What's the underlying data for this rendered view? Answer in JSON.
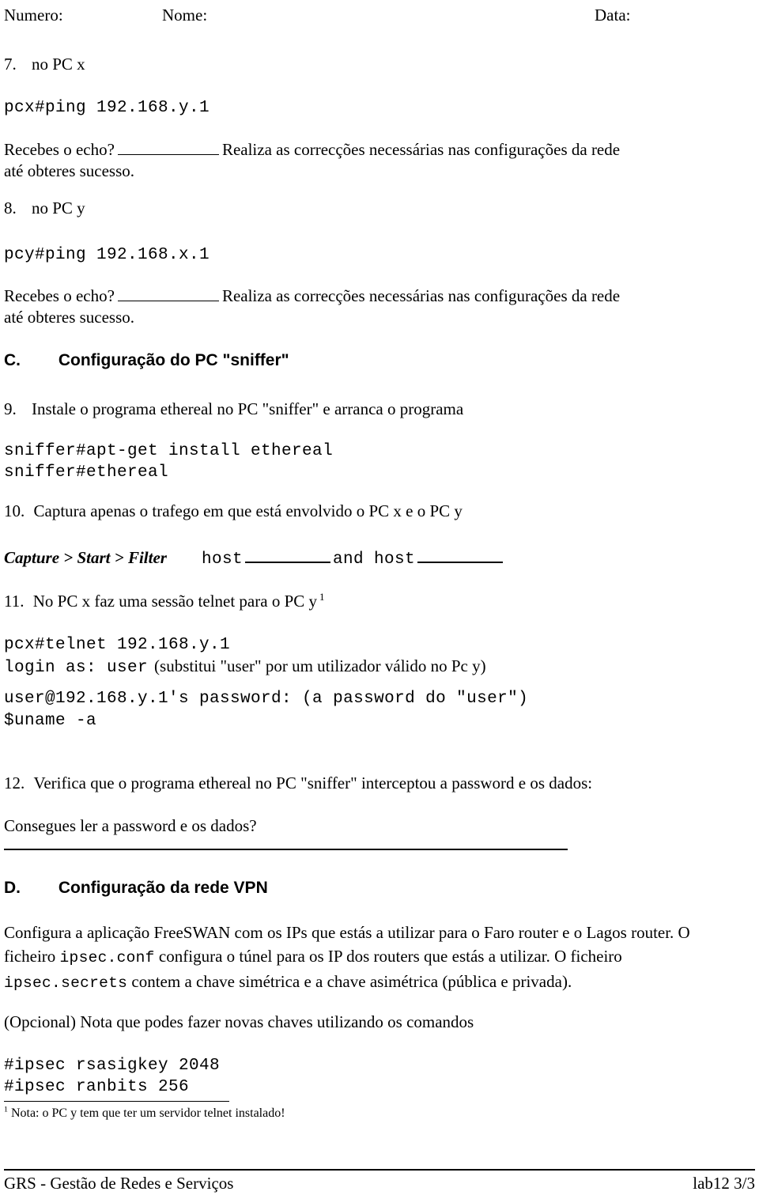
{
  "header": {
    "numero_label": "Numero:",
    "nome_label": "Nome:",
    "data_label": "Data:"
  },
  "items": {
    "item7": {
      "number": "7.",
      "text": "no PC x",
      "code": "pcx#ping 192.168.y.1",
      "question_before": "Recebes o echo?",
      "question_after": "Realiza as correcções necessárias nas configurações da rede",
      "question_line2": "até obteres sucesso."
    },
    "item8": {
      "number": "8.",
      "text": "no PC y",
      "code": "pcy#ping 192.168.x.1",
      "question_before": "Recebes o echo?",
      "question_after": "Realiza as correcções necessárias nas configurações da rede",
      "question_line2": "até obteres sucesso."
    },
    "item9": {
      "number": "9.",
      "text": "Instale o programa ethereal no PC \"sniffer\" e arranca o programa",
      "code_line1": "sniffer#apt-get install ethereal",
      "code_line2": "sniffer#ethereal"
    },
    "item10": {
      "number": "10.",
      "text": "Captura apenas o trafego em que está envolvido o PC x  e o PC y",
      "menu_path": "Capture > Start > Filter",
      "filter_host1": "host",
      "filter_and": "and host"
    },
    "item11": {
      "number": "11.",
      "text": "No PC x  faz uma sessão telnet para o PC y",
      "footnote_marker": "1",
      "code_line1": "pcx#telnet 192.168.y.1",
      "code_line2_mono": "login as: user",
      "code_line2_serif": "(substitui \"user\" por um utilizador válido no Pc y)",
      "code_line3": "user@192.168.y.1's password: (a password do \"user\")",
      "code_line4": "$uname -a"
    },
    "item12": {
      "number": "12.",
      "text": "Verifica que o programa ethereal no PC \"sniffer\" interceptou a password e os dados:",
      "question": "Consegues ler a password e os dados?"
    }
  },
  "sections": {
    "c": {
      "letter": "C.",
      "title": "Configuração do PC \"sniffer\""
    },
    "d": {
      "letter": "D.",
      "title": "Configuração  da rede VPN"
    }
  },
  "vpn": {
    "para1_a": "Configura a aplicação FreeSWAN com os IPs que estás a utilizar para o Faro router e o Lagos router. O ficheiro ",
    "para1_mono1": "ipsec.conf",
    "para1_b": " configura o túnel para os IP dos routers que estás a utilizar. O ficheiro ",
    "para1_mono2": "ipsec.secrets",
    "para1_c": " contem a chave simétrica e a chave asimétrica (pública e privada).",
    "para2": "(Opcional) Nota que podes fazer novas chaves utilizando os comandos",
    "code_line1": "#ipsec rsasigkey 2048",
    "code_line2": "#ipsec ranbits 256"
  },
  "footnote": {
    "marker": "1",
    "text": "Nota: o PC y tem que ter um servidor telnet instalado!"
  },
  "footer": {
    "left": "GRS - Gestão de Redes e Serviços",
    "right": "lab12 3/3"
  }
}
